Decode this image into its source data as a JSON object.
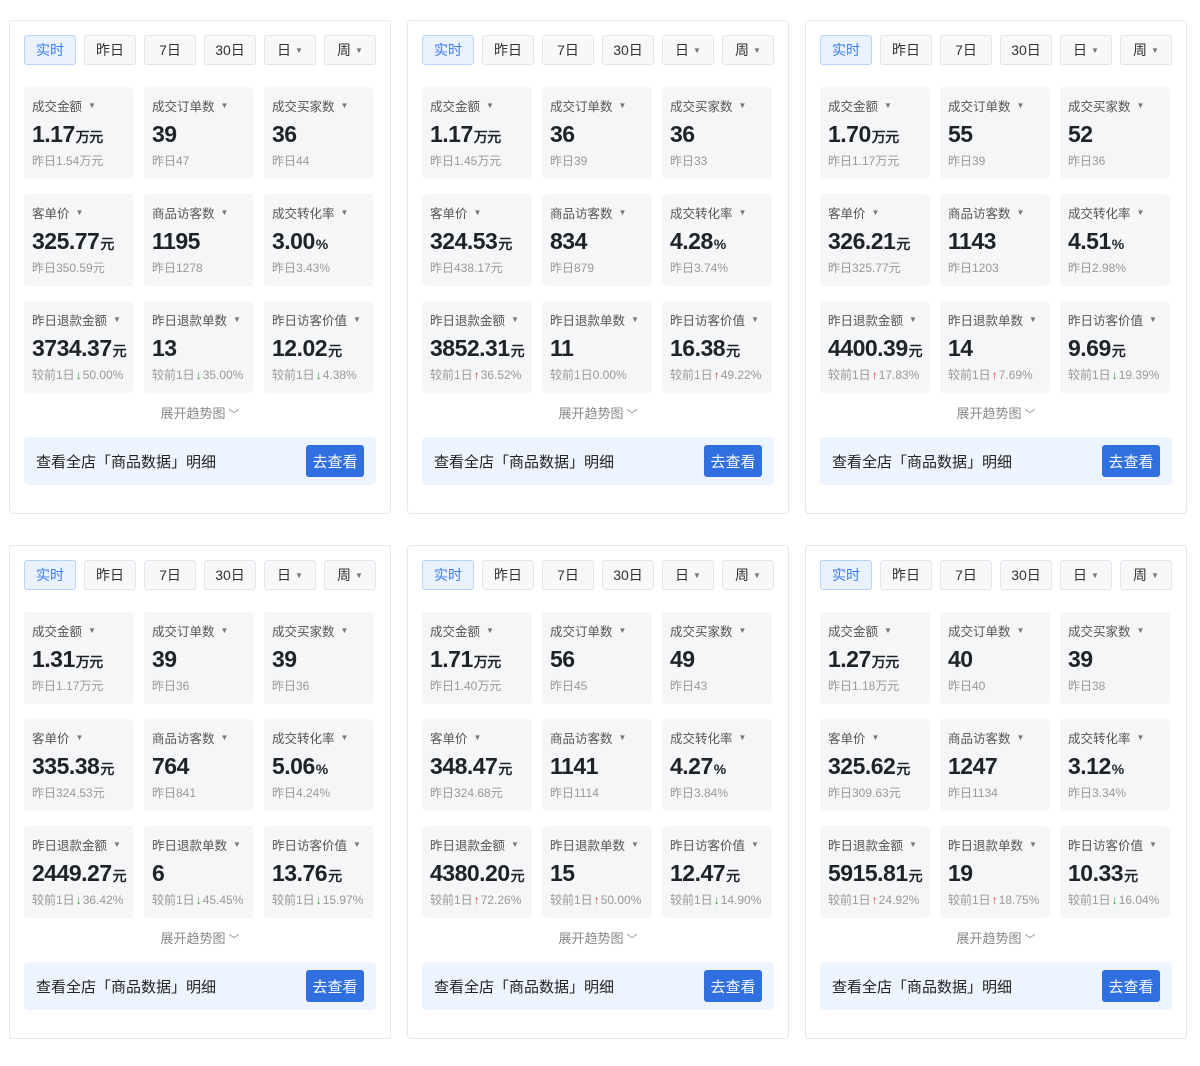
{
  "tabs": [
    "实时",
    "昨日",
    "7日",
    "30日",
    "日",
    "周"
  ],
  "expand_label": "展开趋势图",
  "footer_text": "查看全店「商品数据」明细",
  "footer_button": "去查看",
  "panels": [
    {
      "cards": [
        {
          "label": "成交金额",
          "value": "1.17",
          "unit": "万元",
          "sub": "昨日1.54万元"
        },
        {
          "label": "成交订单数",
          "value": "39",
          "unit": "",
          "sub": "昨日47"
        },
        {
          "label": "成交买家数",
          "value": "36",
          "unit": "",
          "sub": "昨日44"
        },
        {
          "label": "客单价",
          "value": "325.77",
          "unit": "元",
          "sub": "昨日350.59元"
        },
        {
          "label": "商品访客数",
          "value": "1195",
          "unit": "",
          "sub": "昨日1278"
        },
        {
          "label": "成交转化率",
          "value": "3.00",
          "unit": "%",
          "sub": "昨日3.43%"
        },
        {
          "label": "昨日退款金额",
          "value": "3734.37",
          "unit": "元",
          "sub": "较前1日",
          "dir": "down",
          "change": "50.00%"
        },
        {
          "label": "昨日退款单数",
          "value": "13",
          "unit": "",
          "sub": "较前1日",
          "dir": "down",
          "change": "35.00%"
        },
        {
          "label": "昨日访客价值",
          "value": "12.02",
          "unit": "元",
          "sub": "较前1日",
          "dir": "down",
          "change": "4.38%"
        }
      ]
    },
    {
      "cards": [
        {
          "label": "成交金额",
          "value": "1.17",
          "unit": "万元",
          "sub": "昨日1.45万元"
        },
        {
          "label": "成交订单数",
          "value": "36",
          "unit": "",
          "sub": "昨日39"
        },
        {
          "label": "成交买家数",
          "value": "36",
          "unit": "",
          "sub": "昨日33"
        },
        {
          "label": "客单价",
          "value": "324.53",
          "unit": "元",
          "sub": "昨日438.17元"
        },
        {
          "label": "商品访客数",
          "value": "834",
          "unit": "",
          "sub": "昨日879"
        },
        {
          "label": "成交转化率",
          "value": "4.28",
          "unit": "%",
          "sub": "昨日3.74%"
        },
        {
          "label": "昨日退款金额",
          "value": "3852.31",
          "unit": "元",
          "sub": "较前1日",
          "dir": "up",
          "change": "36.52%"
        },
        {
          "label": "昨日退款单数",
          "value": "11",
          "unit": "",
          "sub": "较前1日0.00%"
        },
        {
          "label": "昨日访客价值",
          "value": "16.38",
          "unit": "元",
          "sub": "较前1日",
          "dir": "up",
          "change": "49.22%"
        }
      ]
    },
    {
      "cards": [
        {
          "label": "成交金额",
          "value": "1.70",
          "unit": "万元",
          "sub": "昨日1.17万元"
        },
        {
          "label": "成交订单数",
          "value": "55",
          "unit": "",
          "sub": "昨日39"
        },
        {
          "label": "成交买家数",
          "value": "52",
          "unit": "",
          "sub": "昨日36"
        },
        {
          "label": "客单价",
          "value": "326.21",
          "unit": "元",
          "sub": "昨日325.77元"
        },
        {
          "label": "商品访客数",
          "value": "1143",
          "unit": "",
          "sub": "昨日1203"
        },
        {
          "label": "成交转化率",
          "value": "4.51",
          "unit": "%",
          "sub": "昨日2.98%"
        },
        {
          "label": "昨日退款金额",
          "value": "4400.39",
          "unit": "元",
          "sub": "较前1日",
          "dir": "up",
          "change": "17.83%"
        },
        {
          "label": "昨日退款单数",
          "value": "14",
          "unit": "",
          "sub": "较前1日",
          "dir": "up",
          "change": "7.69%"
        },
        {
          "label": "昨日访客价值",
          "value": "9.69",
          "unit": "元",
          "sub": "较前1日",
          "dir": "down",
          "change": "19.39%"
        }
      ]
    },
    {
      "cards": [
        {
          "label": "成交金额",
          "value": "1.31",
          "unit": "万元",
          "sub": "昨日1.17万元"
        },
        {
          "label": "成交订单数",
          "value": "39",
          "unit": "",
          "sub": "昨日36"
        },
        {
          "label": "成交买家数",
          "value": "39",
          "unit": "",
          "sub": "昨日36"
        },
        {
          "label": "客单价",
          "value": "335.38",
          "unit": "元",
          "sub": "昨日324.53元"
        },
        {
          "label": "商品访客数",
          "value": "764",
          "unit": "",
          "sub": "昨日841"
        },
        {
          "label": "成交转化率",
          "value": "5.06",
          "unit": "%",
          "sub": "昨日4.24%"
        },
        {
          "label": "昨日退款金额",
          "value": "2449.27",
          "unit": "元",
          "sub": "较前1日",
          "dir": "down",
          "change": "36.42%"
        },
        {
          "label": "昨日退款单数",
          "value": "6",
          "unit": "",
          "sub": "较前1日",
          "dir": "down",
          "change": "45.45%"
        },
        {
          "label": "昨日访客价值",
          "value": "13.76",
          "unit": "元",
          "sub": "较前1日",
          "dir": "down",
          "change": "15.97%"
        }
      ]
    },
    {
      "cards": [
        {
          "label": "成交金额",
          "value": "1.71",
          "unit": "万元",
          "sub": "昨日1.40万元"
        },
        {
          "label": "成交订单数",
          "value": "56",
          "unit": "",
          "sub": "昨日45"
        },
        {
          "label": "成交买家数",
          "value": "49",
          "unit": "",
          "sub": "昨日43"
        },
        {
          "label": "客单价",
          "value": "348.47",
          "unit": "元",
          "sub": "昨日324.68元"
        },
        {
          "label": "商品访客数",
          "value": "1141",
          "unit": "",
          "sub": "昨日1114"
        },
        {
          "label": "成交转化率",
          "value": "4.27",
          "unit": "%",
          "sub": "昨日3.84%"
        },
        {
          "label": "昨日退款金额",
          "value": "4380.20",
          "unit": "元",
          "sub": "较前1日",
          "dir": "up",
          "change": "72.26%"
        },
        {
          "label": "昨日退款单数",
          "value": "15",
          "unit": "",
          "sub": "较前1日",
          "dir": "up",
          "change": "50.00%"
        },
        {
          "label": "昨日访客价值",
          "value": "12.47",
          "unit": "元",
          "sub": "较前1日",
          "dir": "down",
          "change": "14.90%"
        }
      ]
    },
    {
      "cards": [
        {
          "label": "成交金额",
          "value": "1.27",
          "unit": "万元",
          "sub": "昨日1.18万元"
        },
        {
          "label": "成交订单数",
          "value": "40",
          "unit": "",
          "sub": "昨日40"
        },
        {
          "label": "成交买家数",
          "value": "39",
          "unit": "",
          "sub": "昨日38"
        },
        {
          "label": "客单价",
          "value": "325.62",
          "unit": "元",
          "sub": "昨日309.63元"
        },
        {
          "label": "商品访客数",
          "value": "1247",
          "unit": "",
          "sub": "昨日1134"
        },
        {
          "label": "成交转化率",
          "value": "3.12",
          "unit": "%",
          "sub": "昨日3.34%"
        },
        {
          "label": "昨日退款金额",
          "value": "5915.81",
          "unit": "元",
          "sub": "较前1日",
          "dir": "up",
          "change": "24.92%"
        },
        {
          "label": "昨日退款单数",
          "value": "19",
          "unit": "",
          "sub": "较前1日",
          "dir": "up",
          "change": "18.75%"
        },
        {
          "label": "昨日访客价值",
          "value": "10.33",
          "unit": "元",
          "sub": "较前1日",
          "dir": "down",
          "change": "16.04%"
        }
      ]
    }
  ]
}
